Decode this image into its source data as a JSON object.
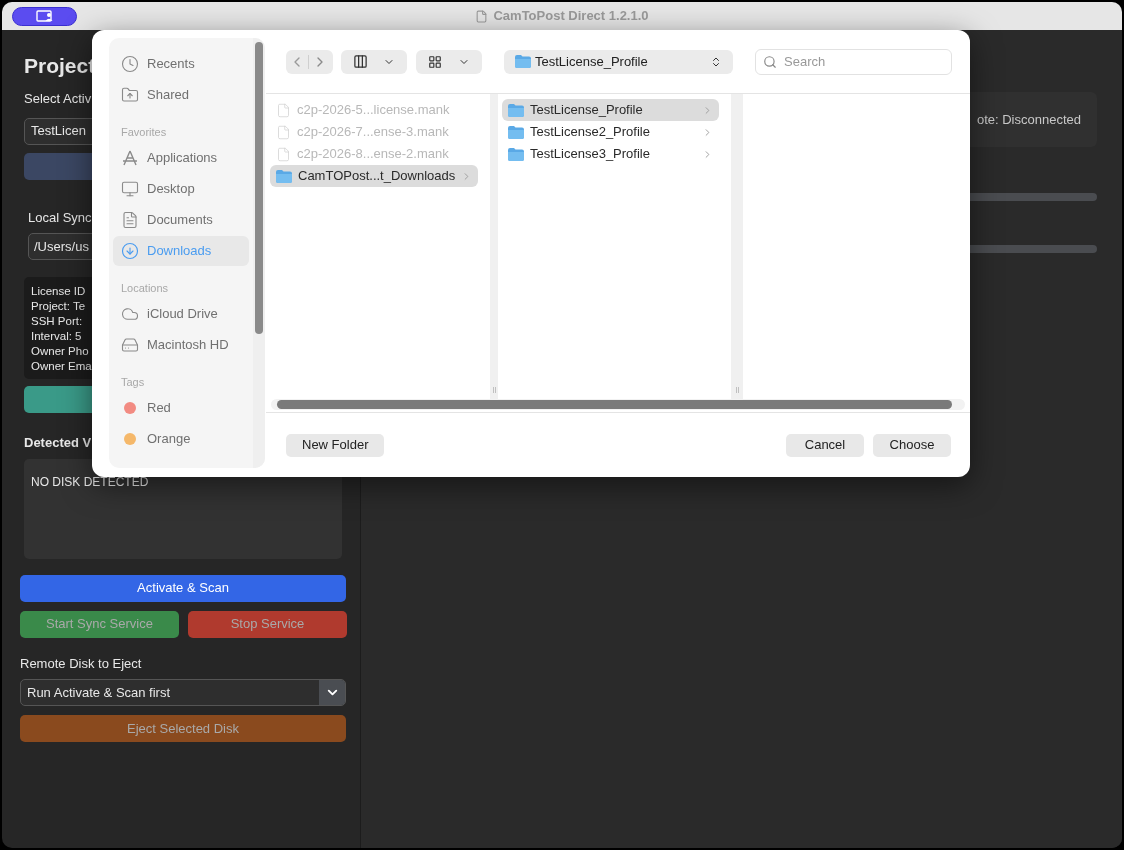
{
  "window": {
    "title": "CamToPost Direct 1.2.1.0"
  },
  "left_panel": {
    "heading": "Project",
    "select_label": "Select Activ",
    "select_value": "TestLicen",
    "sync_label": "Local Sync",
    "sync_path": "/Users/us",
    "info_lines": [
      "License ID",
      "Project: Te",
      "SSH Port: ",
      "Interval: 5",
      "Owner Pho",
      "Owner Ema"
    ],
    "volumes_label": "Detected V",
    "volumes_text": "NO DISK DETECTED",
    "actions": [
      {
        "label": "Activate & Scan",
        "kind": "primary",
        "disabled": false
      }
    ],
    "service_buttons": [
      {
        "label": "Start Sync Service",
        "kind": "start",
        "disabled": true
      },
      {
        "label": "Stop Service",
        "kind": "stop",
        "disabled": true
      }
    ],
    "eject_label": "Remote Disk to Eject",
    "eject_select": "Run Activate & Scan first",
    "eject_button": {
      "label": "Eject Selected Disk",
      "disabled": true
    }
  },
  "right_panel": {
    "status_text": "ote: Disconnected",
    "bars": [
      {
        "level": 0
      },
      {
        "level": 0
      }
    ]
  },
  "dialog": {
    "sidebar": [
      {
        "items": [
          {
            "label": "Recents",
            "kind": "place",
            "selected": false
          },
          {
            "label": "Shared",
            "kind": "place",
            "selected": false
          }
        ]
      },
      {
        "title": "Favorites",
        "items": [
          {
            "label": "Applications",
            "kind": "place",
            "selected": false
          },
          {
            "label": "Desktop",
            "kind": "place",
            "selected": false
          },
          {
            "label": "Documents",
            "kind": "place",
            "selected": false
          },
          {
            "label": "Downloads",
            "kind": "place",
            "selected": true
          }
        ]
      },
      {
        "title": "Locations",
        "items": [
          {
            "label": "iCloud Drive",
            "kind": "place",
            "selected": false
          },
          {
            "label": "Macintosh HD",
            "kind": "place",
            "selected": false
          }
        ]
      },
      {
        "title": "Tags",
        "items": [
          {
            "label": "Red",
            "kind": "tag",
            "color": "#f28b82",
            "selected": false
          },
          {
            "label": "Orange",
            "kind": "tag",
            "color": "#f5b86a",
            "selected": false
          }
        ]
      }
    ],
    "path": "TestLicense_Profile",
    "search": {
      "placeholder": "Search"
    },
    "columns": [
      [
        {
          "name": "c2p-2026-5...license.mank",
          "kind": "file",
          "disabled": true,
          "selected": false
        },
        {
          "name": "c2p-2026-7...ense-3.mank",
          "kind": "file",
          "disabled": true,
          "selected": false
        },
        {
          "name": "c2p-2026-8...ense-2.mank",
          "kind": "file",
          "disabled": true,
          "selected": false
        },
        {
          "name": "CamTOPost...t_Downloads",
          "kind": "folder",
          "disabled": false,
          "selected": true
        }
      ],
      [
        {
          "name": "TestLicense_Profile",
          "kind": "folder",
          "disabled": false,
          "selected": true
        },
        {
          "name": "TestLicense2_Profile",
          "kind": "folder",
          "disabled": false,
          "selected": false
        },
        {
          "name": "TestLicense3_Profile",
          "kind": "folder",
          "disabled": false,
          "selected": false
        }
      ]
    ],
    "buttons": {
      "new_folder": "New Folder",
      "cancel": "Cancel",
      "choose": "Choose"
    }
  }
}
